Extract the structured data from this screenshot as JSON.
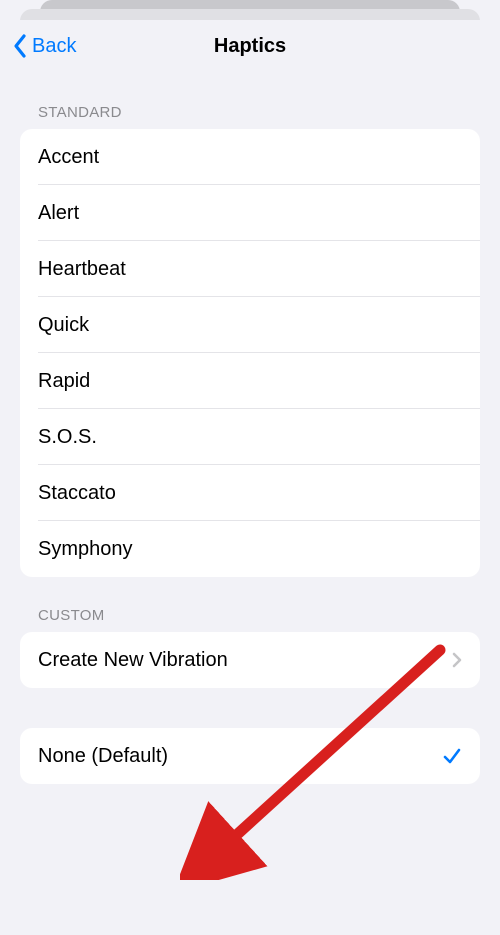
{
  "nav": {
    "back_label": "Back",
    "title": "Haptics"
  },
  "sections": {
    "standard": {
      "header": "STANDARD",
      "items": [
        "Accent",
        "Alert",
        "Heartbeat",
        "Quick",
        "Rapid",
        "S.O.S.",
        "Staccato",
        "Symphony"
      ]
    },
    "custom": {
      "header": "CUSTOM",
      "create_label": "Create New Vibration"
    },
    "none": {
      "label": "None (Default)",
      "selected": true
    }
  }
}
